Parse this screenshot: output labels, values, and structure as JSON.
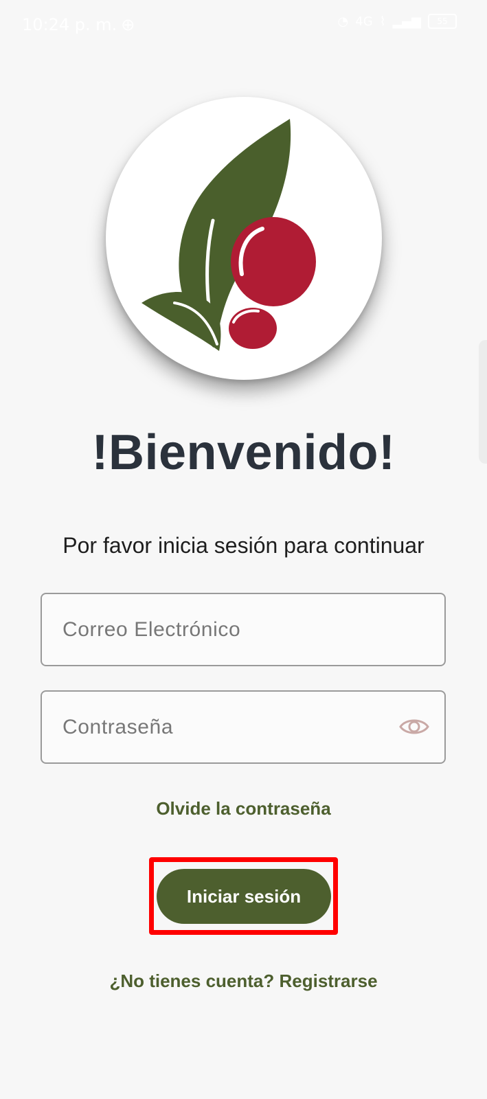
{
  "status_bar": {
    "time": "10:24 p. m.",
    "network": "4G",
    "battery": "55"
  },
  "logo": {
    "icon": "coffee-leaf-berry-logo",
    "colors": {
      "leaf": "#4a5f2c",
      "berry": "#b01c34"
    }
  },
  "welcome": {
    "title": "!Bienvenido!",
    "subtitle": "Por favor inicia sesión para continuar"
  },
  "form": {
    "email_placeholder": "Correo Electrónico",
    "email_value": "",
    "password_placeholder": "Contraseña",
    "password_value": "",
    "toggle_visibility_icon": "eye-icon"
  },
  "links": {
    "forgot_password": "Olvide la contraseña",
    "register": "¿No tienes cuenta? Registrarse"
  },
  "actions": {
    "login_label": "Iniciar sesión"
  },
  "colors": {
    "brand": "#4d5f2e",
    "title": "#2b323c",
    "highlight": "#ff0000",
    "background": "#f7f7f7"
  }
}
